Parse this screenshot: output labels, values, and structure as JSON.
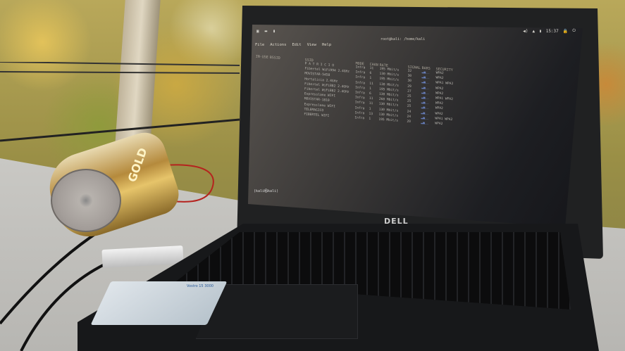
{
  "terminal": {
    "window_title": "root@kali: /home/kali",
    "menu": [
      "File",
      "Actions",
      "Edit",
      "View",
      "Help"
    ],
    "columns": [
      "IN-USE",
      "BSSID",
      "SSID",
      "MODE",
      "CHAN",
      "RATE",
      "SIGNAL",
      "BARS",
      "SECURITY"
    ],
    "rows": [
      {
        "ssid": "P A T R I C I O",
        "mode": "Infra",
        "chan": "11",
        "rate": "195 Mbit/s",
        "signal": "32",
        "security": "WPA2"
      },
      {
        "ssid": "Fibertel WiFi994 2.4GHz",
        "mode": "Infra",
        "chan": "6",
        "rate": "130 Mbit/s",
        "signal": "30",
        "security": "WPA2"
      },
      {
        "ssid": "MOVISTAR-5458",
        "mode": "Infra",
        "chan": "1",
        "rate": "195 Mbit/s",
        "signal": "30",
        "security": "WPA1 WPA2"
      },
      {
        "ssid": "Hortalicia 2.4GHz",
        "mode": "Infra",
        "chan": "11",
        "rate": "130 Mbit/s",
        "signal": "29",
        "security": "WPA2"
      },
      {
        "ssid": "Fibertel WiFi882 2.4GHz",
        "mode": "Infra",
        "chan": "1",
        "rate": "195 Mbit/s",
        "signal": "27",
        "security": "WPA2"
      },
      {
        "ssid": "Fibertel WiFi882 2.4GHz",
        "mode": "Infra",
        "chan": "6",
        "rate": "130 Mbit/s",
        "signal": "25",
        "security": "WPA1 WPA2"
      },
      {
        "ssid": "Expresslane WIFI",
        "mode": "Infra",
        "chan": "11",
        "rate": "260 Mbit/s",
        "signal": "25",
        "security": "WPA2"
      },
      {
        "ssid": "MOVISTAR-1810",
        "mode": "Infra",
        "chan": "11",
        "rate": "130 Mbit/s",
        "signal": "25",
        "security": "WPA2"
      },
      {
        "ssid": "Expresslane WIFI",
        "mode": "Infra",
        "chan": "1",
        "rate": "130 Mbit/s",
        "signal": "24",
        "security": "WPA2"
      },
      {
        "ssid": "TELEMAGICO",
        "mode": "Infra",
        "chan": "13",
        "rate": "130 Mbit/s",
        "signal": "24",
        "security": "WPA1 WPA2"
      },
      {
        "ssid": "FIBERTEL WIFI",
        "mode": "Infra",
        "chan": "1",
        "rate": "195 Mbit/s",
        "signal": "20",
        "security": "WPA2"
      }
    ],
    "prompt": "(kali㉿kali)"
  },
  "topbar": {
    "time": "15:37"
  },
  "laptop": {
    "brand": "DELL"
  },
  "can": {
    "label": "GOLD"
  },
  "sticker": {
    "title": "Vostro 15 3000"
  }
}
